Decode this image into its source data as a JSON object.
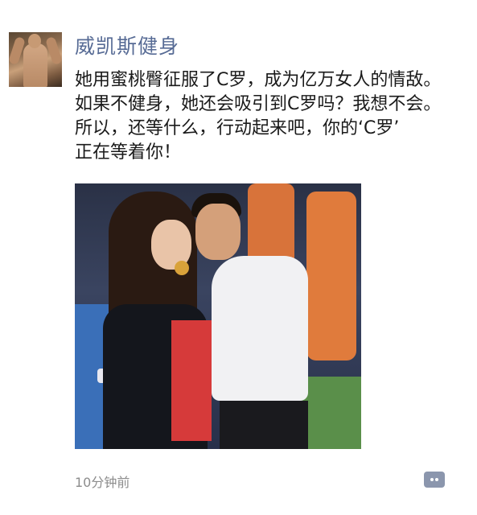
{
  "post": {
    "username": "威凯斯健身",
    "text_lines": [
      "她用蜜桃臀征服了C罗，成为亿万女人的情敌。",
      "如果不健身，她还会吸引到C罗吗？我想不会。",
      "所以，还等什么，行动起来吧，你的‘C罗’",
      "正在等着你！"
    ],
    "time": "10分钟前",
    "avatar_icon": "avatar-photo",
    "comment_icon": "comment-icon"
  }
}
